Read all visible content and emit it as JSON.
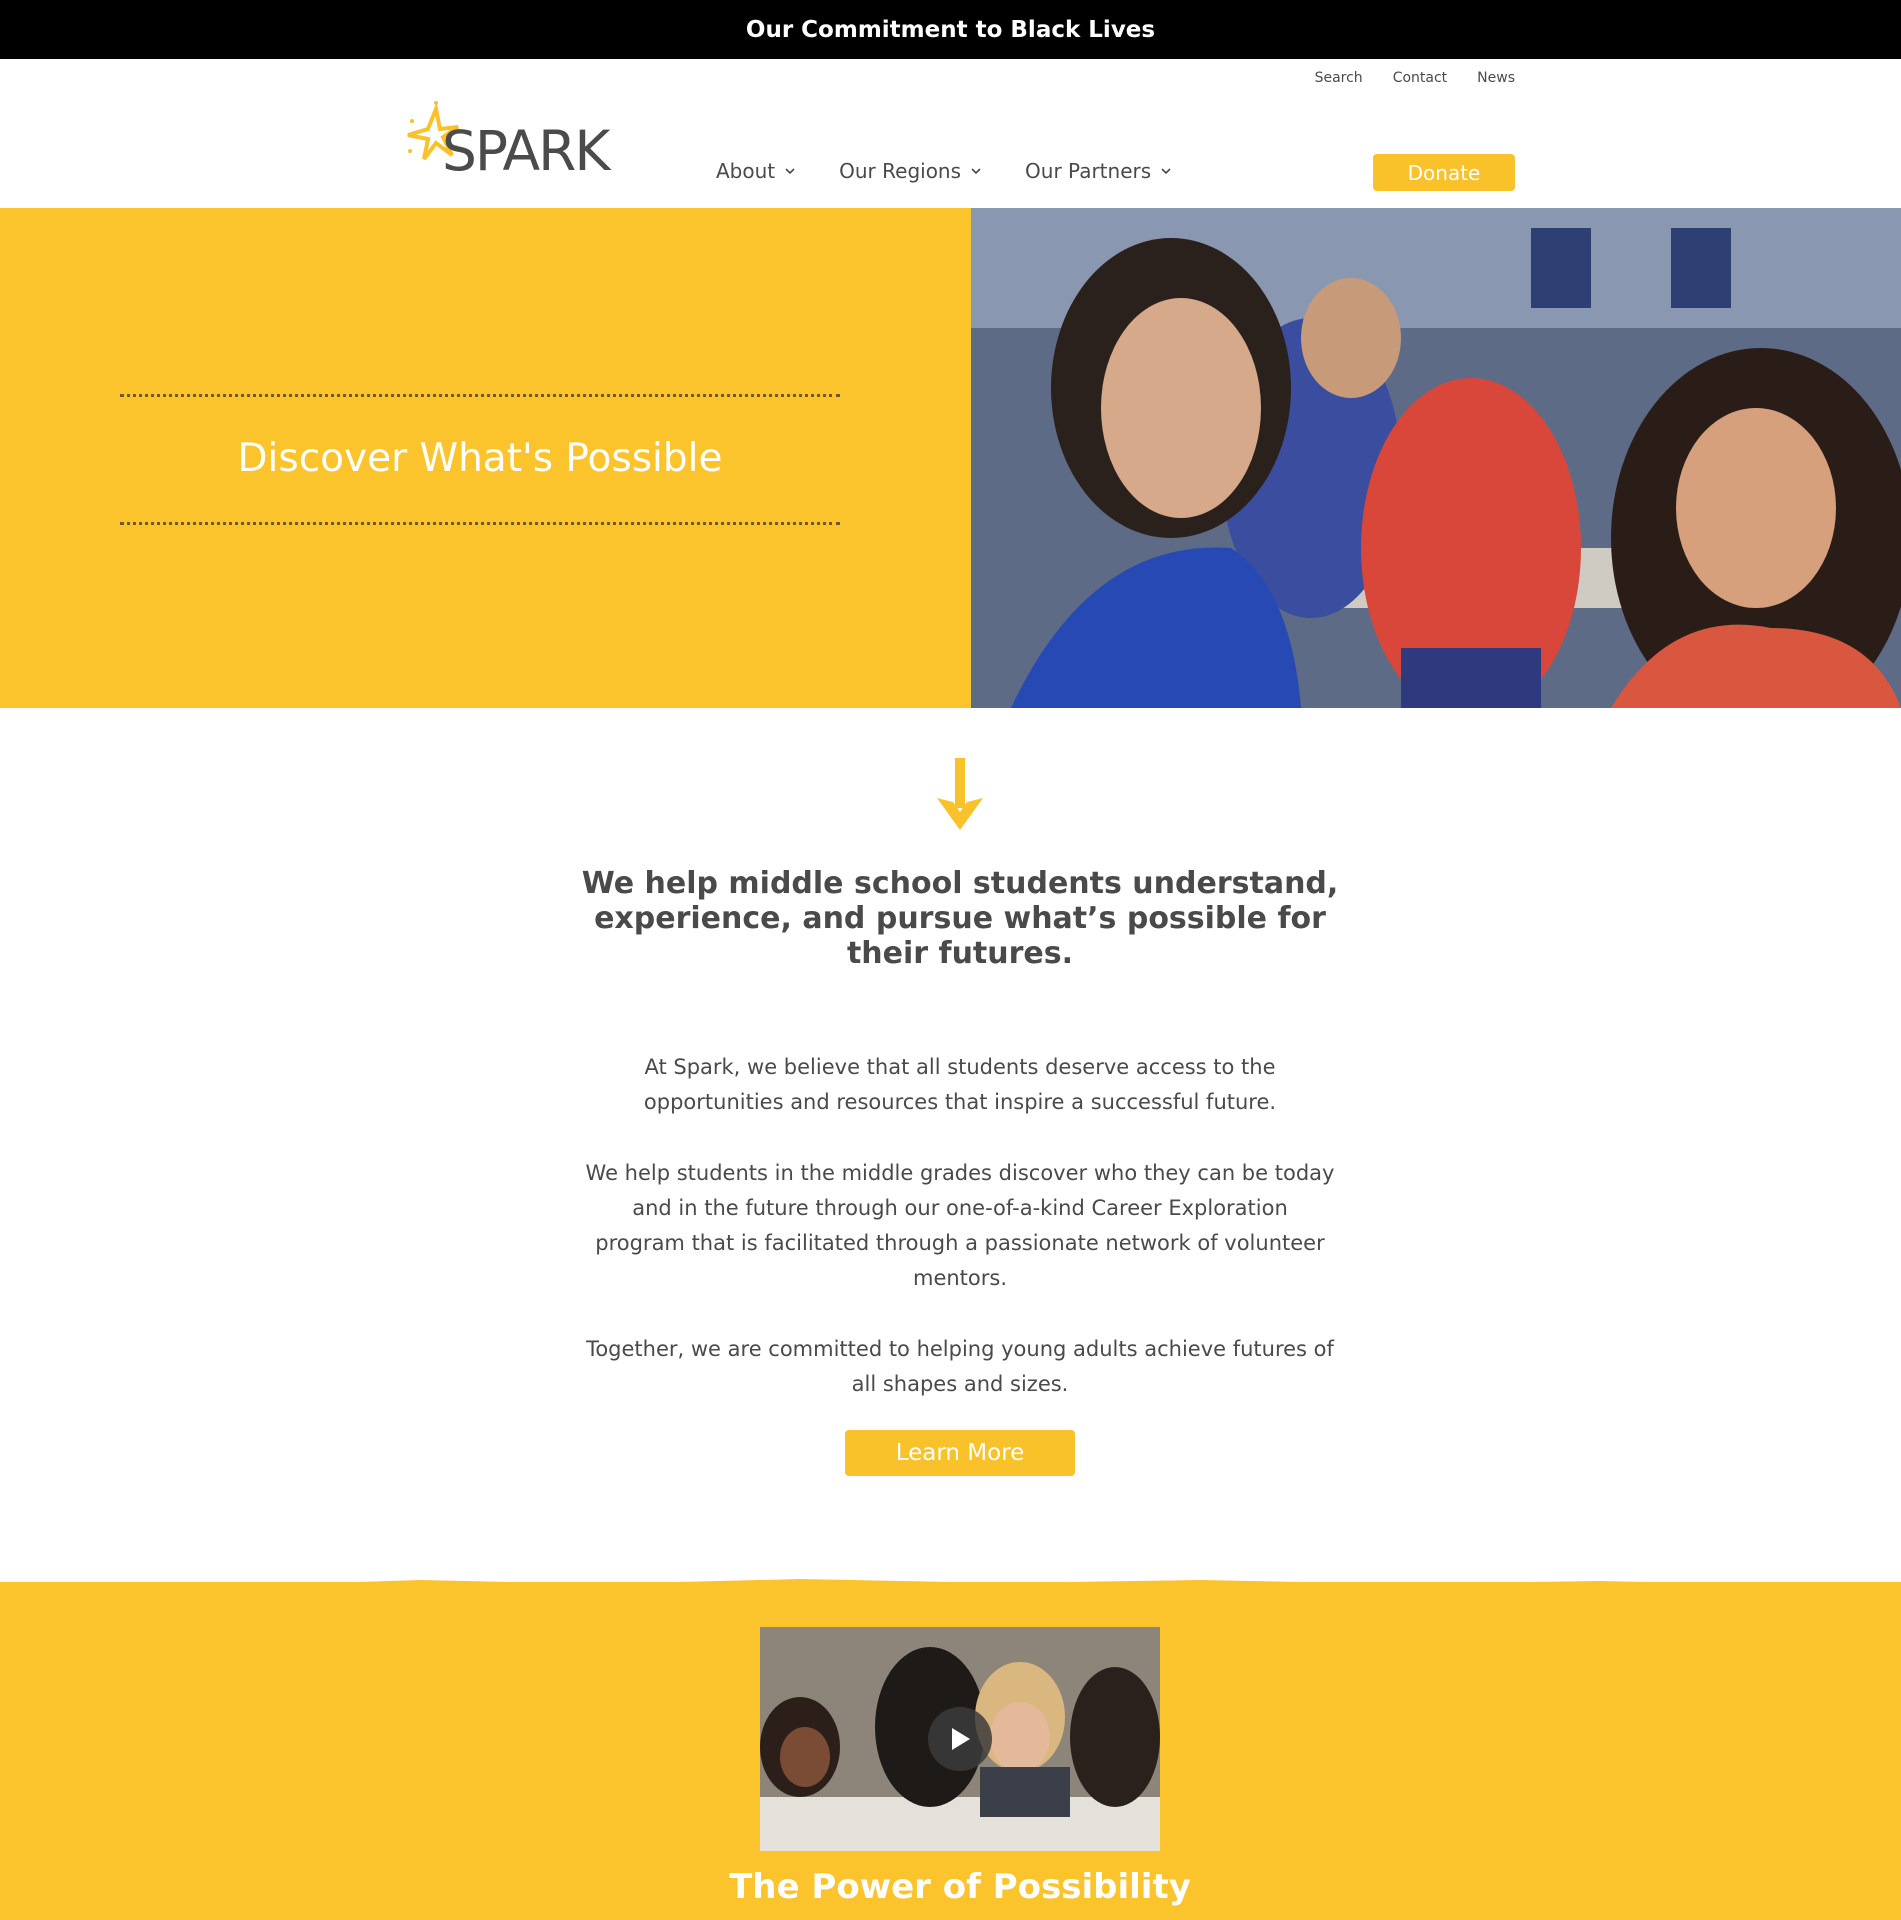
{
  "topbar": {
    "link": "Our Commitment to Black Lives"
  },
  "header": {
    "utility": [
      "Search",
      "Contact",
      "News"
    ],
    "logo_text": "SPARK",
    "nav": [
      "About",
      "Our Regions",
      "Our Partners"
    ],
    "donate": "Donate"
  },
  "hero": {
    "title": "Discover What's Possible"
  },
  "intro": {
    "headline": "We help middle school students understand, experience, and pursue what’s possible for their futures.",
    "p1": "At Spark, we believe that all students deserve access to the opportunities and resources that inspire a successful future.",
    "p2": "We help students in the middle grades discover who they can be today and in the future through our one-of-a-kind Career Exploration program that is facilitated through a passionate network of volunteer mentors.",
    "p3": "Together, we are committed to helping young adults achieve futures of all shapes and sizes.",
    "cta": "Learn More"
  },
  "video_section": {
    "title": "The Power of Possibility"
  },
  "colors": {
    "accent": "#fbc42d",
    "button": "#f9c22b",
    "text": "#4a4a4a",
    "topbar": "#000000"
  }
}
